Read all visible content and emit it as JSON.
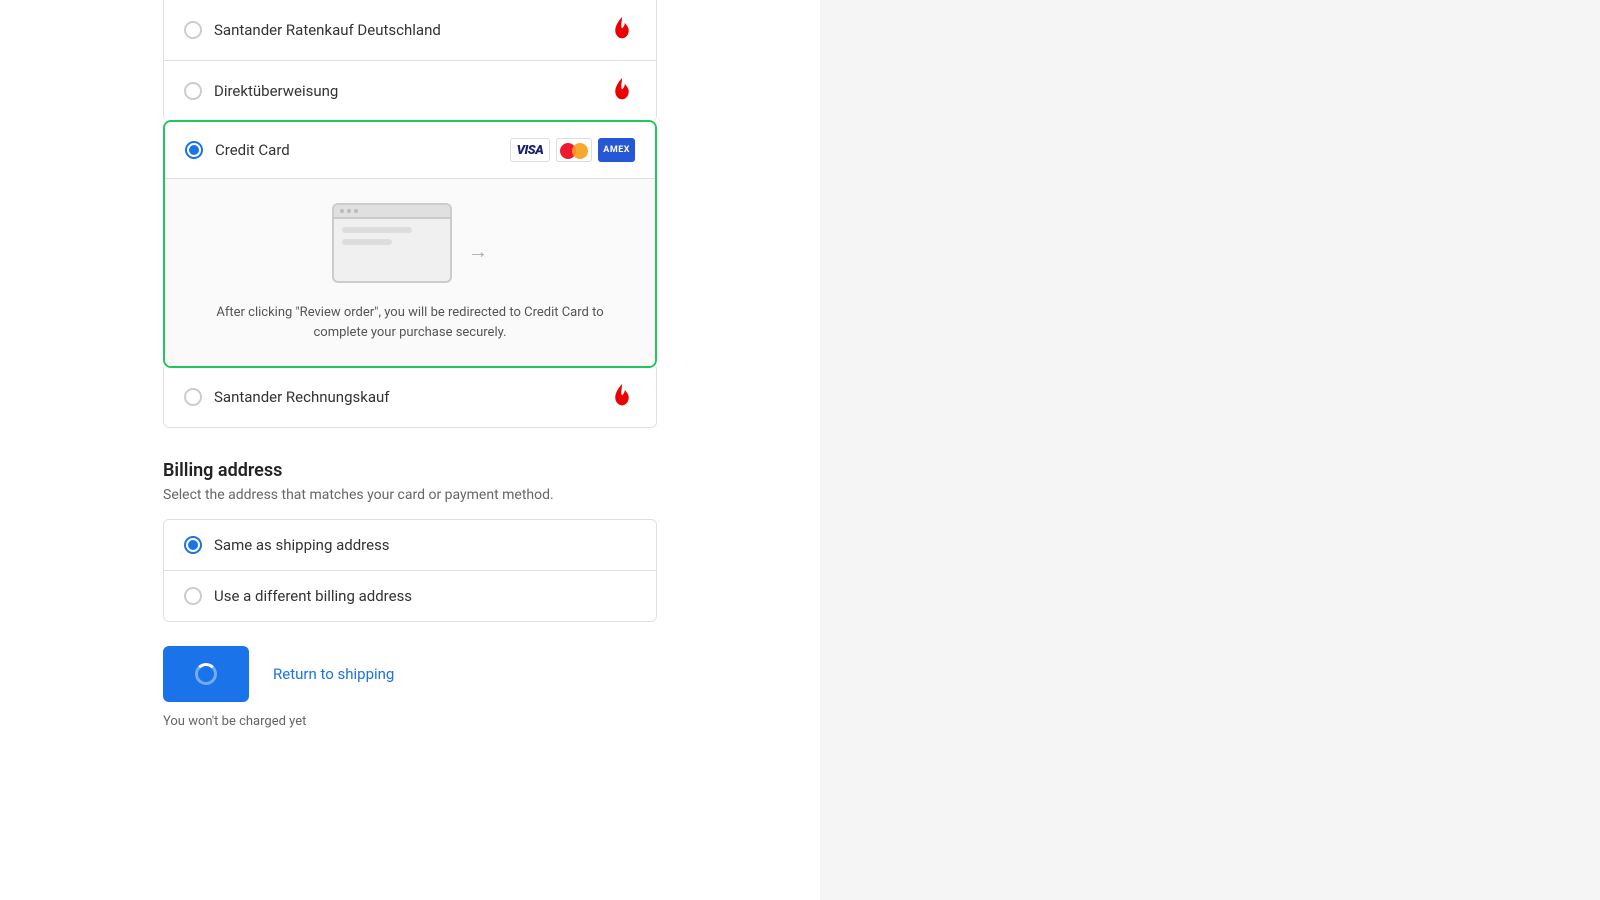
{
  "payment": {
    "options": [
      {
        "id": "santander-ratenkauf",
        "label": "Santander Ratenkauf Deutschland",
        "icon": "santander",
        "selected": false
      },
      {
        "id": "direktueberweisung",
        "label": "Direktüberweisung",
        "icon": "santander",
        "selected": false
      },
      {
        "id": "credit-card",
        "label": "Credit Card",
        "icon": "card-logos",
        "selected": true
      },
      {
        "id": "santander-rechnung",
        "label": "Santander Rechnungskauf",
        "icon": "santander",
        "selected": false
      }
    ],
    "credit_card_redirect_text": "After clicking \"Review order\", you will be redirected to Credit Card to complete your purchase securely."
  },
  "billing": {
    "title": "Billing address",
    "subtitle": "Select the address that matches your card or payment method.",
    "options": [
      {
        "id": "same-as-shipping",
        "label": "Same as shipping address",
        "selected": true
      },
      {
        "id": "different-billing",
        "label": "Use a different billing address",
        "selected": false
      }
    ]
  },
  "actions": {
    "return_to_shipping": "Return to shipping",
    "not_charged": "You won't be charged yet"
  }
}
